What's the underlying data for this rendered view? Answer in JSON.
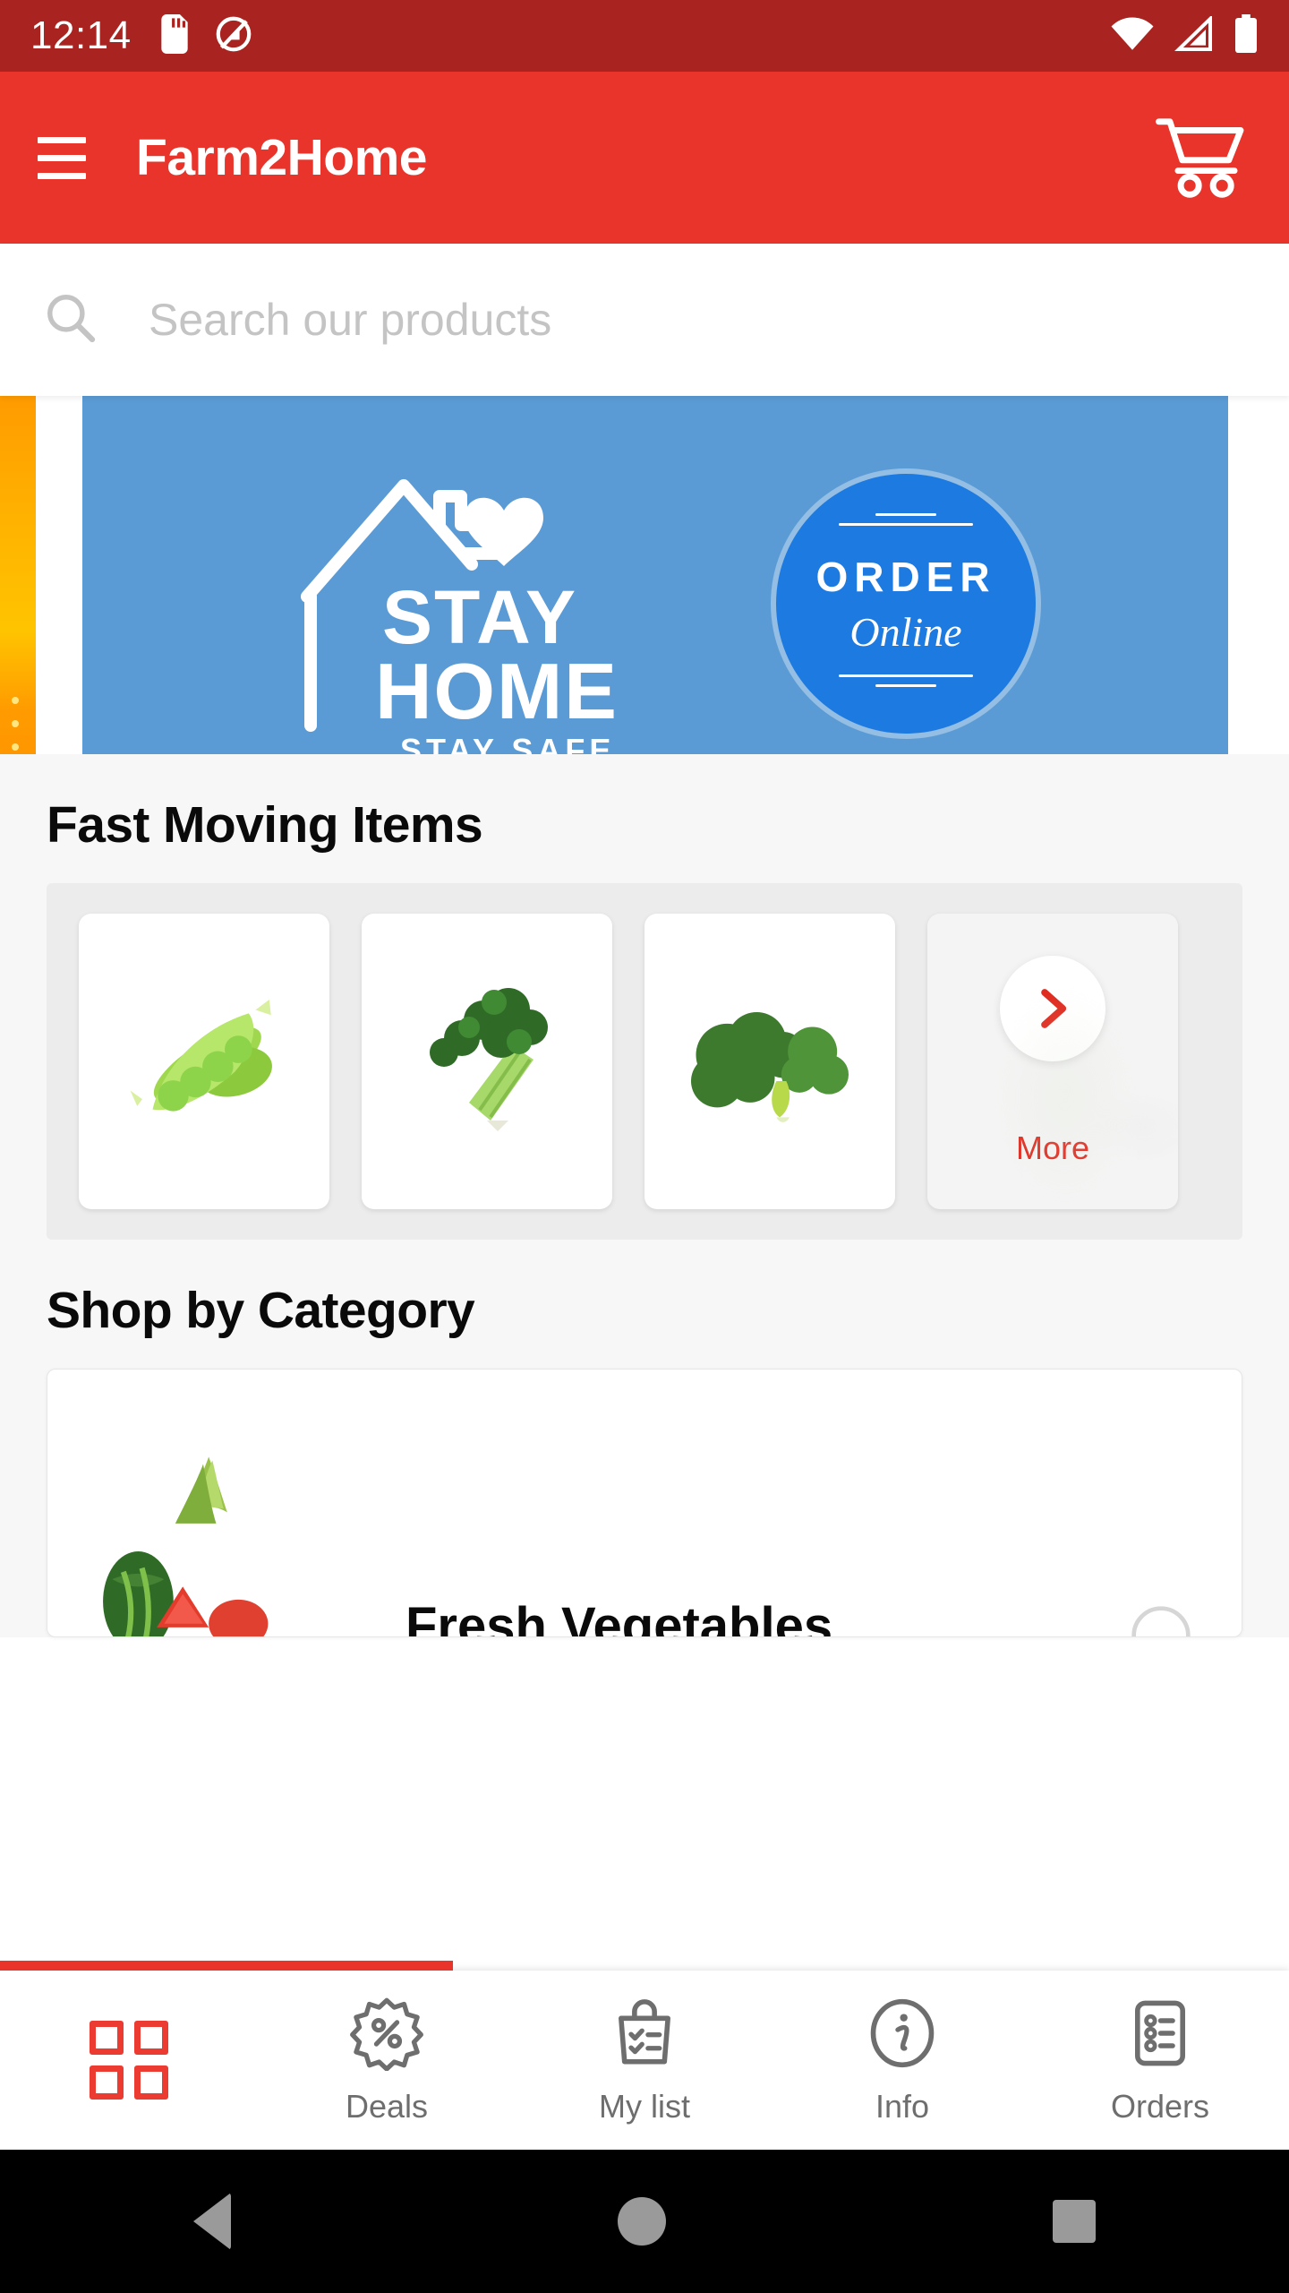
{
  "status_bar": {
    "time": "12:14",
    "icons_left": [
      "sd-card-icon",
      "silent-mode-icon"
    ],
    "icons_right": [
      "wifi-icon",
      "cellular-signal-icon",
      "battery-icon"
    ]
  },
  "app_bar": {
    "menu_icon": "hamburger-menu-icon",
    "title": "Farm2Home",
    "cart_icon": "shopping-cart-icon",
    "background_color": "#e8342a"
  },
  "search": {
    "icon": "search-icon",
    "placeholder": "Search our products",
    "value": ""
  },
  "carousel": {
    "previous_slide_color": "#ffa300",
    "current_slide": {
      "headline_line1": "STAY",
      "headline_line2": "HOME",
      "subline": "STAY SAFE",
      "badge_line1": "ORDER",
      "badge_line2": "Online",
      "background_color": "#5b9bd5",
      "badge_color": "#1d7ae0"
    }
  },
  "fast_moving": {
    "title": "Fast Moving Items",
    "items": [
      {
        "name": "green-peas",
        "image": "peas-photo"
      },
      {
        "name": "celery",
        "image": "celery-photo"
      },
      {
        "name": "broccoli",
        "image": "broccoli-photo"
      }
    ],
    "more": {
      "label": "More",
      "icon": "chevron-right-icon",
      "color": "#e02b20"
    }
  },
  "shop_by_category": {
    "title": "Shop by Category",
    "categories": [
      {
        "name": "Fresh Vegetables",
        "image": "mixed-produce-photo"
      }
    ]
  },
  "bottom_nav": {
    "items": [
      {
        "label": "",
        "icon": "grid-icon",
        "active": true
      },
      {
        "label": "Deals",
        "icon": "discount-tag-icon",
        "active": false
      },
      {
        "label": "My list",
        "icon": "shopping-bag-checklist-icon",
        "active": false
      },
      {
        "label": "Info",
        "icon": "info-circle-icon",
        "active": false
      },
      {
        "label": "Orders",
        "icon": "orders-list-icon",
        "active": false
      }
    ],
    "active_color": "#ec3b30",
    "inactive_color": "#6e6e6e"
  },
  "android_nav": {
    "back_icon": "back-triangle-icon",
    "home_icon": "home-circle-icon",
    "recents_icon": "recents-square-icon"
  }
}
